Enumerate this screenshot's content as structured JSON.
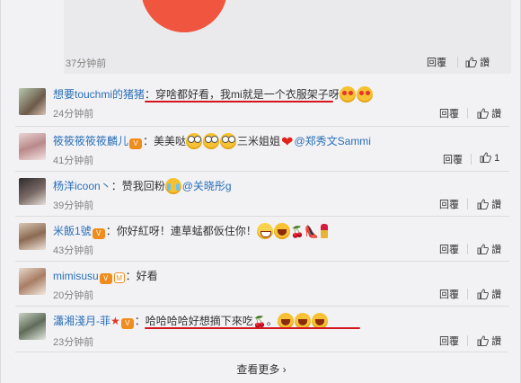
{
  "repost": {
    "time": "37分钟前",
    "reply_label": "回覆",
    "like_label": "讚"
  },
  "comments": [
    {
      "user": "想要touchmi的猪猪",
      "text": "：穿啥都好看，我mi就是一个衣服架子呀",
      "time": "24分钟前",
      "reply": "回覆",
      "like": "讚"
    },
    {
      "user": "筱筱筱筱筱麟儿",
      "text_a": "：美美哒",
      "text_b": "三米姐姐",
      "mention": "@郑秀文Sammi",
      "time": "41分钟前",
      "reply": "回覆",
      "like": "1"
    },
    {
      "user": "杨洋icoon丶",
      "text_a": "：赞我回粉",
      "mention": "@关晓彤g",
      "time": "39分钟前",
      "reply": "回覆",
      "like": "讚"
    },
    {
      "user": "米飯1號",
      "text": "：你好紅呀！連草蜢都仮住你！",
      "time": "43分钟前",
      "reply": "回覆",
      "like": "讚"
    },
    {
      "user": "mimisusu",
      "text": "：好看",
      "time": "20分钟前",
      "reply": "回覆",
      "like": "讚"
    },
    {
      "user": "瀟湘淺月-菲",
      "text": "：哈哈哈哈好想摘下來吃",
      "tail": "。",
      "time": "23分钟前",
      "reply": "回覆",
      "like": "讚"
    }
  ],
  "more_label": "查看更多",
  "colors": {
    "link": "#2a6fb7",
    "highlight": "#d4151d",
    "background": "#f2f2f5"
  }
}
